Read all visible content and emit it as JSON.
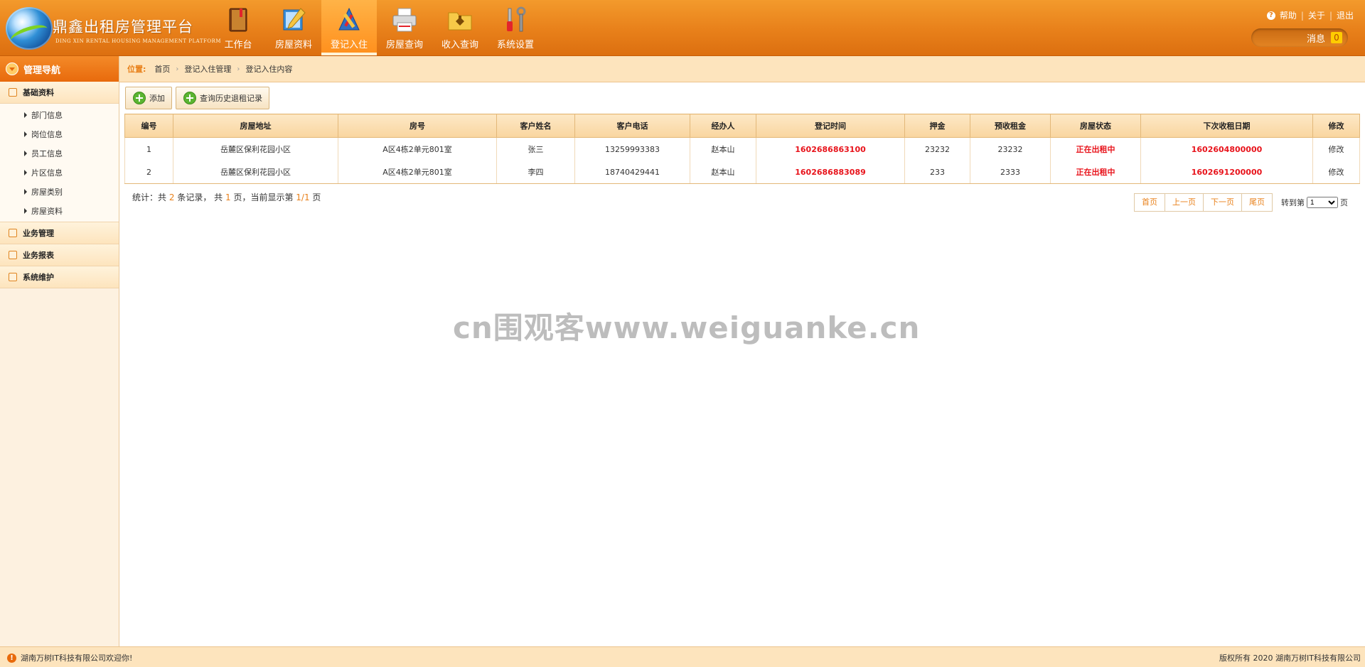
{
  "app": {
    "title": "鼎鑫出租房管理平台",
    "subtitle": "DING XIN RENTAL HOUSING MANAGEMENT PLATFORM"
  },
  "nav": [
    {
      "label": "工作台",
      "icon": "book-icon",
      "active": false
    },
    {
      "label": "房屋资料",
      "icon": "pencil-ruler-icon",
      "active": false
    },
    {
      "label": "登记入住",
      "icon": "tools-icon",
      "active": true
    },
    {
      "label": "房屋查询",
      "icon": "printer-icon",
      "active": false
    },
    {
      "label": "收入查询",
      "icon": "download-folder-icon",
      "active": false
    },
    {
      "label": "系统设置",
      "icon": "wrench-screwdriver-icon",
      "active": false
    }
  ],
  "top_links": {
    "help": "帮助",
    "about": "关于",
    "logout": "退出"
  },
  "messages": {
    "label": "消息",
    "count": "0"
  },
  "sidebar": {
    "header": "管理导航",
    "groups": [
      {
        "label": "基础资料",
        "items": [
          "部门信息",
          "岗位信息",
          "员工信息",
          "片区信息",
          "房屋类别",
          "房屋资料"
        ]
      },
      {
        "label": "业务管理"
      },
      {
        "label": "业务报表"
      },
      {
        "label": "系统维护"
      }
    ]
  },
  "breadcrumb": {
    "label": "位置:",
    "items": [
      "首页",
      "登记入住管理",
      "登记入住内容"
    ]
  },
  "toolbar": {
    "add": "添加",
    "history": "查询历史退租记录"
  },
  "table": {
    "columns": [
      "编号",
      "房屋地址",
      "房号",
      "客户姓名",
      "客户电话",
      "经办人",
      "登记时间",
      "押金",
      "预收租金",
      "房屋状态",
      "下次收租日期",
      "修改"
    ],
    "rows": [
      [
        "1",
        "岳麓区保利花园小区",
        "A区4栋2单元801室",
        "张三",
        "13259993383",
        "赵本山",
        "1602686863100",
        "23232",
        "23232",
        "正在出租中",
        "1602604800000",
        "修改"
      ],
      [
        "2",
        "岳麓区保利花园小区",
        "A区4栋2单元801室",
        "李四",
        "18740429441",
        "赵本山",
        "1602686883089",
        "233",
        "2333",
        "正在出租中",
        "1602691200000",
        "修改"
      ]
    ]
  },
  "stats": {
    "prefix": "统计：共",
    "records": "2",
    "mid1": "条记录，  共",
    "pages": "1",
    "mid2": "页，当前显示第",
    "current": "1/1",
    "suffix": "页"
  },
  "pager": {
    "first": "首页",
    "prev": "上一页",
    "next": "下一页",
    "last": "尾页",
    "jump_prefix": "转到第",
    "jump_value": "1",
    "jump_suffix": "页"
  },
  "footer": {
    "left": "湖南万树IT科技有限公司欢迎你!",
    "right": "版权所有 2020 湖南万树IT科技有限公司"
  },
  "watermark": "cn围观客www.weiguanke.cn",
  "colors": {
    "accent": "#e8801a",
    "status_red": "#e8131b",
    "nav_bg": "#e8801a"
  }
}
